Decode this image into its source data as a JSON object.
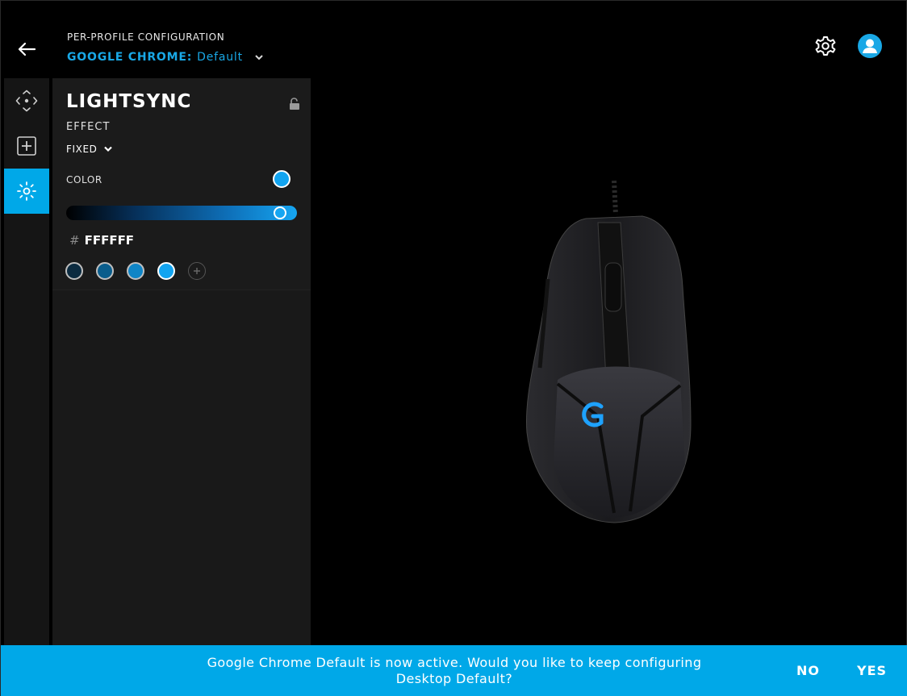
{
  "header": {
    "subtitle": "PER-PROFILE CONFIGURATION",
    "profile_app": "GOOGLE CHROME:",
    "profile_name": "Default"
  },
  "icons": {
    "back": "back-arrow-icon",
    "settings": "gear-icon",
    "account": "user-icon",
    "rail": [
      "move-arrows-icon",
      "add-square-icon",
      "lightsync-icon"
    ],
    "lock": "lock-icon",
    "add_swatch": "plus-circle-icon"
  },
  "panel": {
    "title": "LIGHTSYNC",
    "effect_label": "EFFECT",
    "effect_value": "FIXED",
    "color_label": "COLOR",
    "current_color": "#12a4f0",
    "hex_prefix": "#",
    "hex_value": "FFFFFF",
    "slider_level": 0.95,
    "swatches": [
      "#0c2b40",
      "#0a5d8c",
      "#0f85c6",
      "#12a4f0"
    ]
  },
  "device_logo_color": "#1ea2ff",
  "notice": {
    "message": "Google Chrome Default is now active. Would you like to keep configuring Desktop Default?",
    "no_label": "NO",
    "yes_label": "YES"
  },
  "colors": {
    "accent": "#00a8e8"
  }
}
